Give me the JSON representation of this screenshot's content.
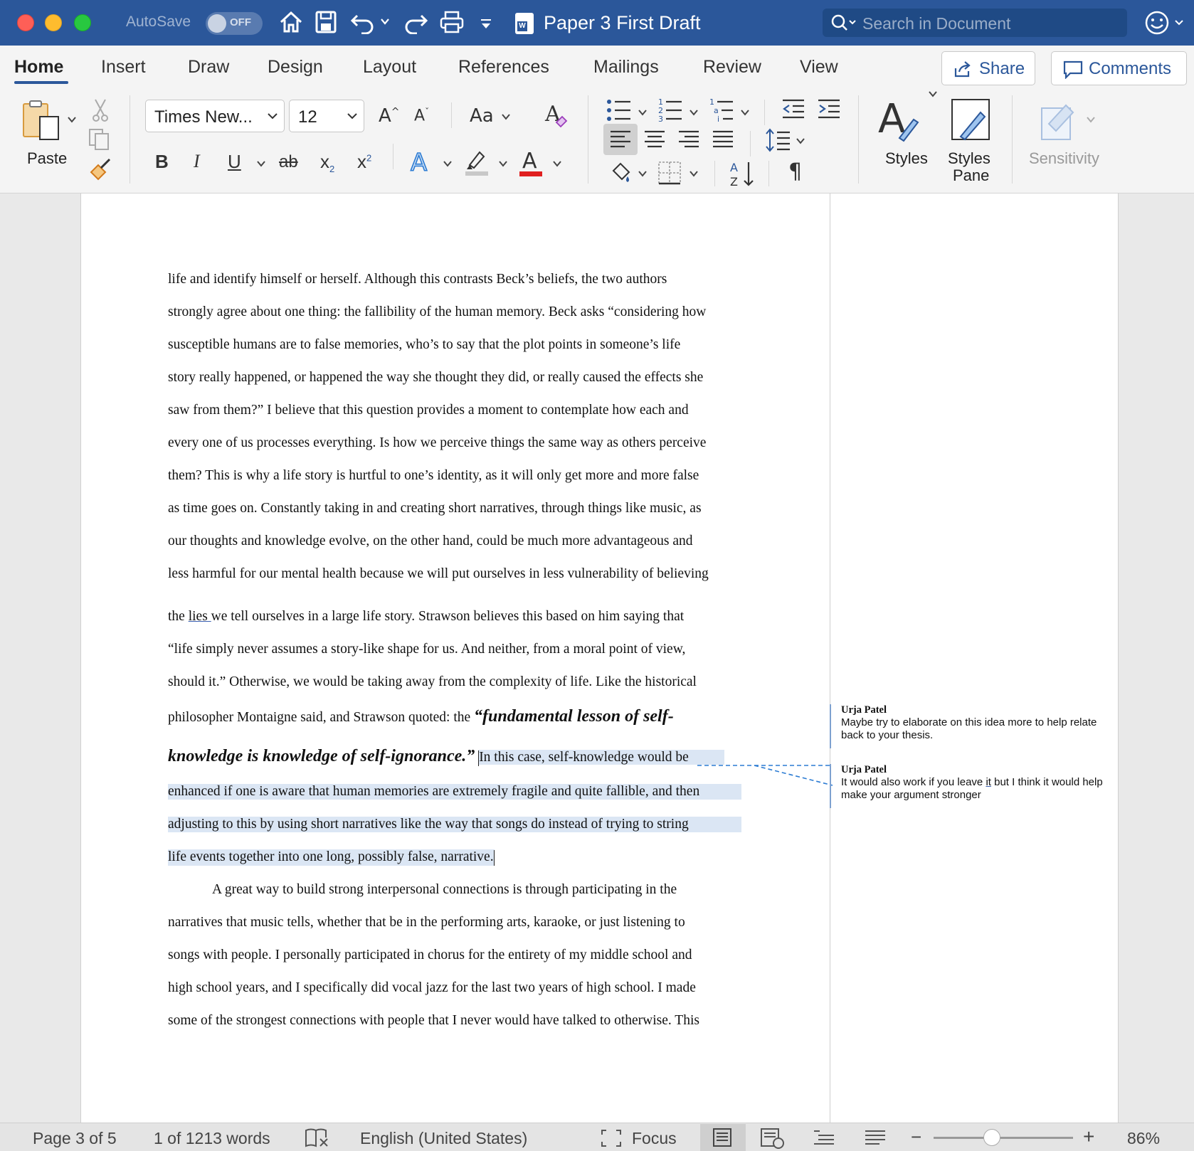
{
  "title_bar": {
    "autosave_label": "AutoSave",
    "autosave_state": "OFF",
    "document_title": "Paper 3 First Draft",
    "search_placeholder": "Search in Document",
    "accent_color": "#2b579a"
  },
  "tabs": [
    {
      "label": "Home",
      "active": true
    },
    {
      "label": "Insert"
    },
    {
      "label": "Draw"
    },
    {
      "label": "Design"
    },
    {
      "label": "Layout"
    },
    {
      "label": "References"
    },
    {
      "label": "Mailings"
    },
    {
      "label": "Review"
    },
    {
      "label": "View"
    }
  ],
  "top_buttons": {
    "share": "Share",
    "comments": "Comments"
  },
  "ribbon": {
    "paste_label": "Paste",
    "font_name": "Times New...",
    "font_size": "12",
    "change_case": "Aa",
    "bold": "B",
    "italic": "I",
    "underline": "U",
    "strikethrough": "ab",
    "subscript": "x",
    "superscript": "x",
    "styles_label": "Styles",
    "styles_pane_label_1": "Styles",
    "styles_pane_label_2": "Pane",
    "sensitivity_label": "Sensitivity",
    "highlight_color": "#c8c8c8",
    "font_color": "#e02020"
  },
  "document": {
    "lines": [
      "life and identify himself or herself. Although this contrasts Beck’s beliefs, the two authors",
      "strongly agree about one thing: the fallibility of the human memory. Beck asks “considering how",
      "susceptible humans are to false memories, who’s to say that the plot points in someone’s life",
      "story really happened, or happened the way she thought they did, or really caused the effects she",
      "saw from them?” I believe that this question provides a moment to contemplate how each and",
      "every one of us processes everything. Is how we perceive things the same way as others perceive",
      "them? This is why a life story is hurtful to one’s identity, as it will only get more and more false",
      "as time goes on. Constantly taking in and creating short narratives, through things like music, as",
      "our thoughts and knowledge evolve, on the other hand, could be much more advantageous and",
      "less harmful for our mental health because we will put ourselves in less vulnerability of believing"
    ],
    "line_lies_pre": "the ",
    "line_lies_word": "lies ",
    "line_lies_post": "we tell ourselves in a large life story. Strawson believes this based on him saying that",
    "line_12": "“life simply never assumes a story-like shape for us. And neither, from a moral point of view,",
    "line_13": "should it.” Otherwise, we would be taking away from the complexity of life. Like the historical",
    "line_14_pre": "philosopher Montaigne said, and Strawson quoted: the ",
    "line_14_quote": "“fundamental lesson of self-",
    "line_15_quote": "knowledge is knowledge of self-ignorance.”",
    "line_15_hl": "In this case, self-knowledge would be",
    "hl_lines": [
      "enhanced if one is aware that human memories are extremely fragile and quite fallible, and then",
      "adjusting to this by using short narratives like the way that songs do instead of trying to string",
      "life events together into one long, possibly false, narrative."
    ],
    "para2_lines": [
      "A great way to build strong interpersonal connections is through participating in the",
      "narratives that music tells, whether that be in the performing arts, karaoke, or just listening to",
      "songs with people. I personally participated in chorus for the entirety of my middle school and",
      "high school years, and I specifically did vocal jazz for the last two years of high school. I made",
      "some of the strongest connections with people that I never would have talked to otherwise. This"
    ]
  },
  "comments": [
    {
      "author": "Urja Patel",
      "text": "Maybe try to elaborate on this idea more to help relate back to your thesis."
    },
    {
      "author": "Urja Patel",
      "text_pre": "It would also work if you leave ",
      "text_link": "it",
      "text_post": " but I think it would help make your argument stronger"
    }
  ],
  "status_bar": {
    "page": "Page 3 of 5",
    "words": "1 of 1213 words",
    "language": "English (United States)",
    "focus": "Focus",
    "zoom": "86%",
    "zoom_minus": "−",
    "zoom_plus": "+"
  }
}
